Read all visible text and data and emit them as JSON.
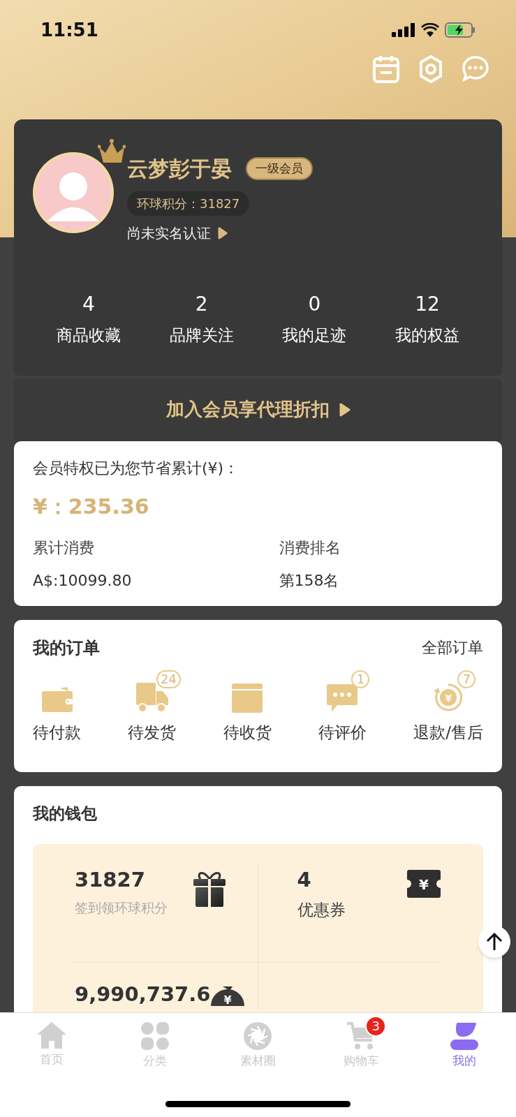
{
  "status_bar": {
    "time": "11:51"
  },
  "profile": {
    "name": "云梦彭于晏",
    "level_badge": "一级会员",
    "points": "环球积分：31827",
    "verify_link": "尚未实名认证"
  },
  "stats": [
    {
      "value": "4",
      "label": "商品收藏"
    },
    {
      "value": "2",
      "label": "品牌关注"
    },
    {
      "value": "0",
      "label": "我的足迹"
    },
    {
      "value": "12",
      "label": "我的权益"
    }
  ],
  "join_banner": "加入会员享代理折扣",
  "savings": {
    "title": "会员特权已为您节省累计(¥)：",
    "amount": "¥：235.36",
    "items": [
      {
        "label": "累计消费",
        "value": "A$:10099.80"
      },
      {
        "label": "消费排名",
        "value": "第158名"
      }
    ]
  },
  "orders": {
    "title": "我的订单",
    "all_link": "全部订单",
    "items": [
      {
        "kind": "wallet",
        "label": "待付款"
      },
      {
        "kind": "truck",
        "label": "待发货",
        "badge": "24"
      },
      {
        "kind": "box",
        "label": "待收货"
      },
      {
        "kind": "chat",
        "label": "待评价",
        "badge": "1"
      },
      {
        "kind": "refund",
        "label": "退款/售后",
        "badge": "7",
        "symbol": "¥"
      }
    ]
  },
  "wallet": {
    "title": "我的钱包",
    "items": [
      {
        "kind": "gift",
        "value": "31827",
        "label": "签到领环球积分"
      },
      {
        "kind": "ticket",
        "value": "4",
        "label": "优惠券",
        "symbol": "¥"
      },
      {
        "kind": "moneybag",
        "value": "9,990,737.6",
        "symbol": "¥"
      }
    ]
  },
  "tab_bar": [
    {
      "kind": "home",
      "label": "首页",
      "selected": false
    },
    {
      "kind": "grid",
      "label": "分类",
      "selected": false
    },
    {
      "kind": "aperture",
      "label": "素材圈",
      "selected": false
    },
    {
      "kind": "cart",
      "label": "购物车",
      "selected": false,
      "badge": "3"
    },
    {
      "kind": "user",
      "label": "我的",
      "selected": true
    }
  ]
}
